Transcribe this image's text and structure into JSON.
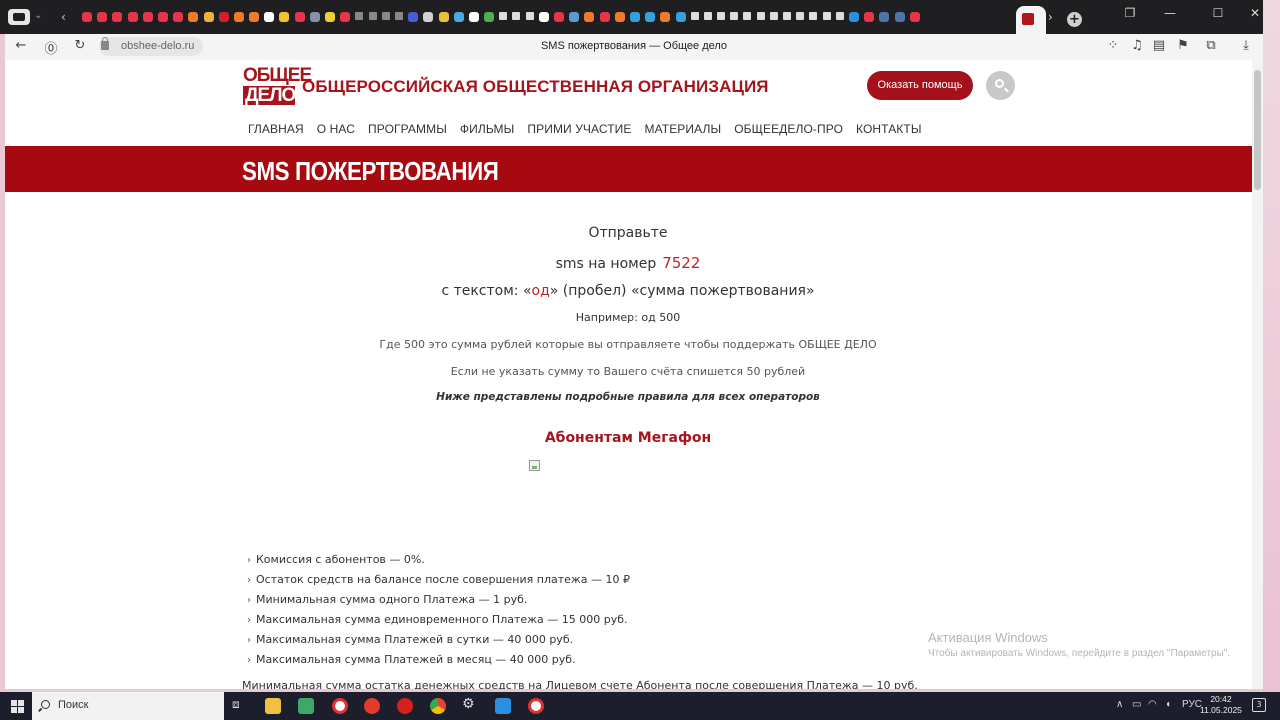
{
  "browser": {
    "tab_title": "SMS пожертвования — Общее дело",
    "url": "obshee-delo.ru",
    "colors": {
      "tabstrip": "#1f1f22",
      "addrbar": "#f4f4f4"
    }
  },
  "site": {
    "logo": {
      "line1": "ОБЩЕЕ",
      "line2": "ДЕЛО"
    },
    "org_title": "ОБЩЕРОССИЙСКАЯ ОБЩЕСТВЕННАЯ ОРГАНИЗАЦИЯ",
    "help_button": "Оказать помощь",
    "search_icon": "search-icon",
    "nav": [
      "ГЛАВНАЯ",
      "О НАС",
      "ПРОГРАММЫ",
      "ФИЛЬМЫ",
      "ПРИМИ УЧАСТИЕ",
      "МАТЕРИАЛЫ",
      "ОБЩЕЕДЕЛО-ПРО",
      "КОНТАКТЫ"
    ],
    "colors": {
      "brand_red": "#a6141c",
      "band_red": "#a6090f"
    }
  },
  "page": {
    "heading": "SMS ПОЖЕРТВОВАНИЯ",
    "send": "Отправьте",
    "sms_to_prefix": "sms на номер",
    "sms_number": "7522",
    "text_prefix": "с текстом:  «",
    "text_code": "од",
    "text_suffix": "» (пробел) «сумма пожертвования»",
    "example": "Например:  од 500",
    "where": "Где 500 это сумма рублей которые вы отправляете чтобы поддержать ОБЩЕЕ ДЕЛО",
    "no_sum": "Если не указать сумму то Вашего счёта спишется 50 рублей",
    "rules_note": "Ниже представлены подробные правила для всех операторов",
    "operator_heading": "Абонентам Мегафон",
    "terms": [
      "Комиссия с абонентов — 0%.",
      "Остаток средств на балансе после совершения платежа — 10 ₽",
      "Минимальная сумма одного Платежа — 1 руб.",
      "Максимальная сумма единовременного Платежа — 15 000 руб.",
      "Максимальная сумма Платежей в сутки — 40 000 руб.",
      "Максимальная сумма Платежей в месяц — 40 000 руб."
    ],
    "footnote": "Минимальная сумма остатка денежных средств на Лицевом счете Абонента после совершения Платежа — 10 руб."
  },
  "windows_activation": {
    "title": "Активация Windows",
    "subtitle": "Чтобы активировать Windows, перейдите в раздел \"Параметры\"."
  },
  "taskbar": {
    "search_placeholder": "Поиск",
    "language": "РУС",
    "time": "20:42",
    "date": "11.05.2025",
    "notifications": "3"
  }
}
